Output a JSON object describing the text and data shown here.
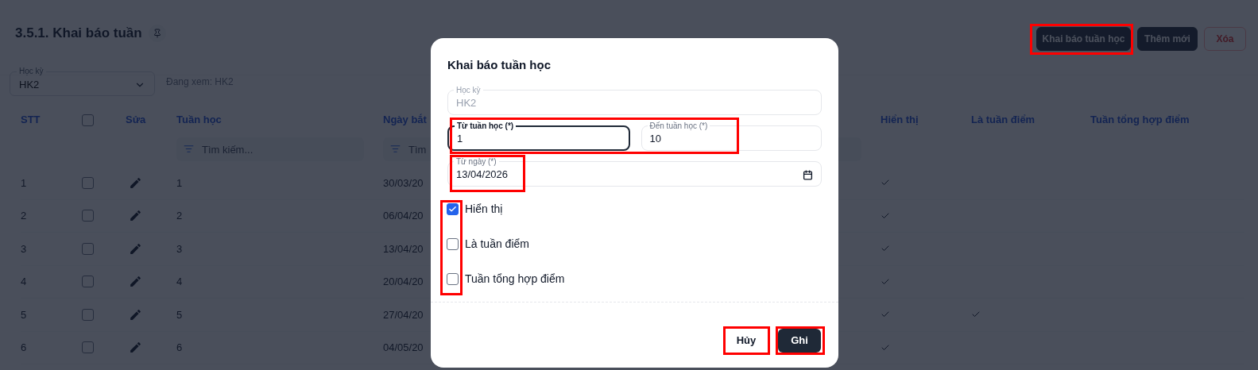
{
  "page": {
    "title": "3.5.1. Khai báo tuần",
    "actions": [
      {
        "label": "Khai báo tuần học",
        "kind": "primary"
      },
      {
        "label": "Thêm mới",
        "kind": "primary"
      },
      {
        "label": "Xóa",
        "kind": "danger"
      }
    ]
  },
  "filter": {
    "label": "Học kỳ",
    "value": "HK2",
    "status": "Đang xem: HK2"
  },
  "table": {
    "columns": [
      {
        "kind": "text",
        "label": "STT"
      },
      {
        "kind": "checkbox",
        "checked": false
      },
      {
        "kind": "text",
        "label": "Sửa"
      },
      {
        "kind": "text",
        "label": "Tuần học",
        "placeholder": "Tìm kiếm..."
      },
      {
        "kind": "text",
        "label": "Ngày bắt",
        "placeholder": "Tìm"
      },
      {
        "kind": "text",
        "label": "Hiển thị"
      },
      {
        "kind": "text",
        "label": "Là tuần điểm"
      },
      {
        "kind": "text",
        "label": "Tuần tổng hợp điểm"
      }
    ],
    "rows": [
      {
        "stt": "1",
        "checked": false,
        "week": "1",
        "start_date": "30/03/20",
        "visible": true,
        "score_week": false,
        "summary_week": false
      },
      {
        "stt": "2",
        "checked": false,
        "week": "2",
        "start_date": "06/04/20",
        "visible": true,
        "score_week": false,
        "summary_week": false
      },
      {
        "stt": "3",
        "checked": false,
        "week": "3",
        "start_date": "13/04/20",
        "visible": true,
        "score_week": false,
        "summary_week": false
      },
      {
        "stt": "4",
        "checked": false,
        "week": "4",
        "start_date": "20/04/20",
        "visible": true,
        "score_week": false,
        "summary_week": false
      },
      {
        "stt": "5",
        "checked": false,
        "week": "5",
        "start_date": "27/04/20",
        "visible": true,
        "score_week": true,
        "summary_week": false
      },
      {
        "stt": "6",
        "checked": false,
        "week": "6",
        "start_date": "04/05/20",
        "visible": true,
        "score_week": false,
        "summary_week": false
      }
    ]
  },
  "dialog": {
    "title": "Khai báo tuần học",
    "field_rows": [
      [
        {
          "kind": "text",
          "label": "Học kỳ",
          "value": "HK2",
          "disabled": true,
          "focused": false
        }
      ],
      [
        {
          "kind": "text",
          "label": "Từ tuần học (*)",
          "value": "1",
          "disabled": false,
          "focused": true
        },
        {
          "kind": "text",
          "label": "Đến tuần học (*)",
          "value": "10",
          "disabled": false,
          "focused": false
        }
      ],
      [
        {
          "kind": "date",
          "label": "Từ ngày (*)",
          "value": "13/04/2026",
          "disabled": false,
          "focused": false
        }
      ]
    ],
    "options": [
      {
        "label": "Hiển thị",
        "checked": true
      },
      {
        "label": "Là tuần điểm",
        "checked": false
      },
      {
        "label": "Tuần tổng hợp điểm",
        "checked": false
      }
    ],
    "buttons": [
      {
        "label": "Hủy",
        "kind": "secondary"
      },
      {
        "label": "Ghi",
        "kind": "primary"
      }
    ]
  }
}
